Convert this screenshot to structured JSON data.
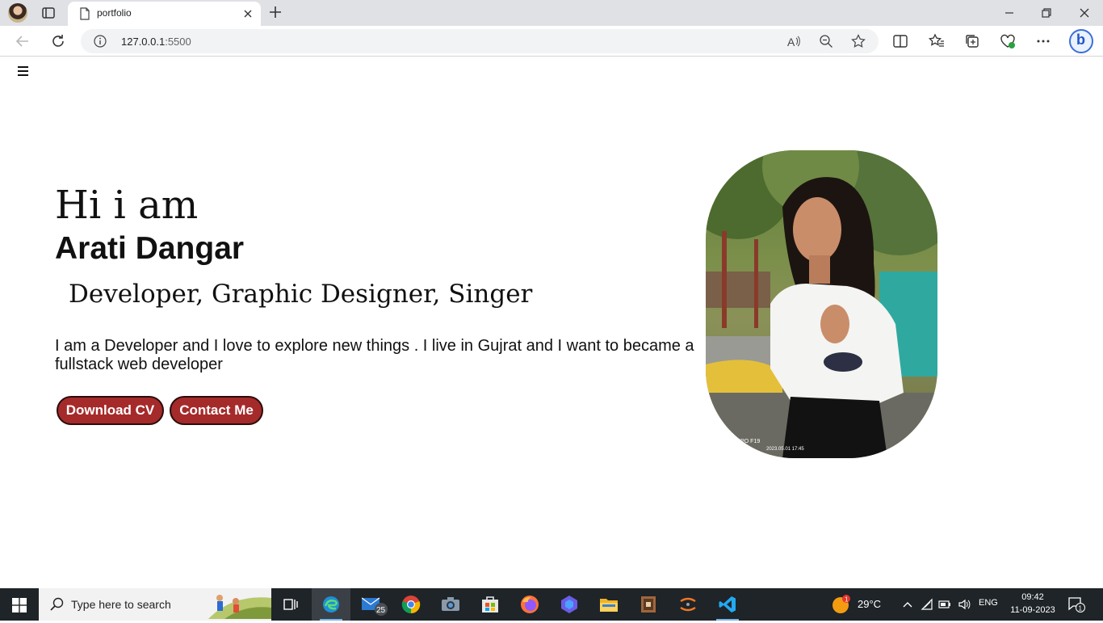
{
  "browser": {
    "tab_title": "portfolio",
    "url_host": "127.0.0.1",
    "url_port": ":5500"
  },
  "hero": {
    "greeting": "Hi i am",
    "name": "Arati Dangar",
    "roles": "Developer, Graphic Designer, Singer",
    "bio": "I am a Developer and I love to explore new things . I live in Gujrat and I want to became a fullstack web developer",
    "download_cv_label": "Download CV",
    "contact_label": "Contact Me"
  },
  "photo": {
    "watermark": "OPPO F19",
    "timestamp": "2023.05.01 17:45"
  },
  "taskbar": {
    "search_placeholder": "Type here to search",
    "mail_badge": "25",
    "temperature": "29°C",
    "weather_badge": "1",
    "language": "ENG",
    "time": "09:42",
    "date": "11-09-2023",
    "notification_count": "1"
  },
  "colors": {
    "button_bg": "#a52a2a",
    "button_border": "#2b0c0c",
    "taskbar_bg": "#1f2428"
  }
}
